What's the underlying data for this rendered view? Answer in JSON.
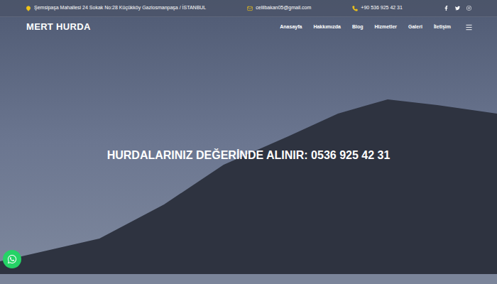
{
  "top_bar": {
    "address": "Şemsipaşa Mahallesi 24 Sokak No:28 Küçükköy Gaziosmanpaşa / İSTANBUL",
    "email": "celilbakan05@gmail.com",
    "phone": "+90 536 925 42 31"
  },
  "header": {
    "logo": "MERT HURDA",
    "nav": [
      {
        "label": "Anasayfa"
      },
      {
        "label": "Hakkımızda"
      },
      {
        "label": "Blog"
      },
      {
        "label": "Hizmetler"
      },
      {
        "label": "Galeri"
      },
      {
        "label": "İletişim"
      }
    ]
  },
  "hero": {
    "heading": "HURDALARINIZ DEĞERİNDE ALINIR: 0536 925 42 31"
  }
}
